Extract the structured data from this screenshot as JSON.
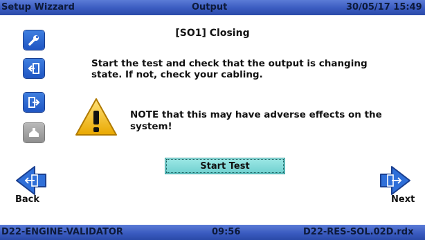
{
  "header": {
    "left_title": "Setup Wizzard",
    "center_title": "Output",
    "datetime": "30/05/17 15:49"
  },
  "sidebar": {
    "items": [
      {
        "icon": "wrench-icon"
      },
      {
        "icon": "input-icon"
      },
      {
        "icon": "output-icon"
      },
      {
        "icon": "machine-icon",
        "disabled": true
      }
    ]
  },
  "main": {
    "heading": "[SO1] Closing",
    "instruction": "Start the test and check that the output is changing state. If not, check your cabling.",
    "note": "NOTE that this may have adverse effects on the system!",
    "start_button": "Start Test"
  },
  "nav": {
    "back_label": "Back",
    "next_label": "Next"
  },
  "footer": {
    "left": "D22-ENGINE-VALIDATOR",
    "center": "09:56",
    "right": "D22-RES-SOL.02D.rdx"
  },
  "colors": {
    "bar": "#3a5bc0",
    "button_blue": "#1f55c2",
    "start_button": "#8fe0de",
    "warning": "#f5b800"
  }
}
